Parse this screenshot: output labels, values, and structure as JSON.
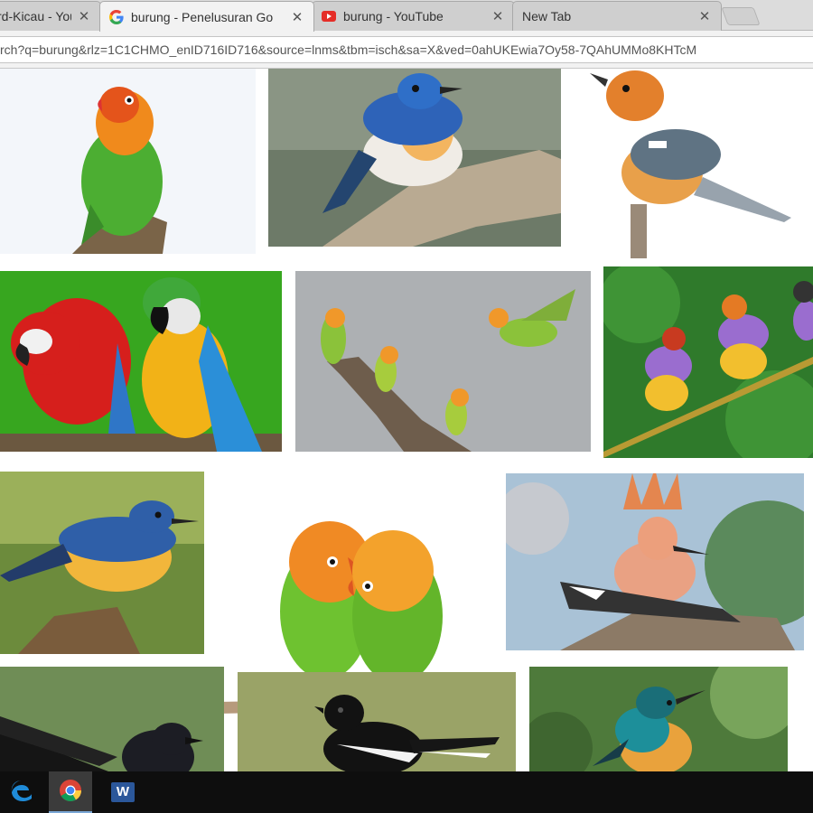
{
  "browser": {
    "tabs": [
      {
        "title": "rd-Kicau - You",
        "icon": "youtube-icon",
        "active": false
      },
      {
        "title": "burung - Penelusuran Go",
        "icon": "google-icon",
        "active": true
      },
      {
        "title": "burung - YouTube",
        "icon": "youtube-icon",
        "active": false
      },
      {
        "title": "New Tab",
        "icon": "",
        "active": false
      }
    ],
    "close_glyph": "✕",
    "url": "rch?q=burung&rlz=1C1CHMO_enID716ID716&source=lnms&tbm=isch&sa=X&ved=0ahUKEwia7Oy58-7QAhUMMo8KHTcM"
  },
  "image_results": [
    {
      "subject": "lovebird on branch"
    },
    {
      "subject": "blue flycatcher on wood"
    },
    {
      "subject": "orange-headed thrush"
    },
    {
      "subject": "red and blue-yellow macaws"
    },
    {
      "subject": "lovebirds on branch, one flying"
    },
    {
      "subject": "gouldian finches on twig"
    },
    {
      "subject": "blue flycatcher on stump"
    },
    {
      "subject": "pair of lovebirds"
    },
    {
      "subject": "hoopoe with crest raised"
    },
    {
      "subject": "dark bird with long tail"
    },
    {
      "subject": "magpie robin"
    },
    {
      "subject": "sunbird"
    }
  ],
  "taskbar": {
    "items": [
      {
        "name": "edge-icon",
        "active": false
      },
      {
        "name": "chrome-icon",
        "active": true
      },
      {
        "name": "word-icon",
        "active": false
      }
    ],
    "word_letter": "W"
  },
  "colors": {
    "taskbar": "#0e0e0e",
    "accent_blue": "#1f8bd8"
  }
}
